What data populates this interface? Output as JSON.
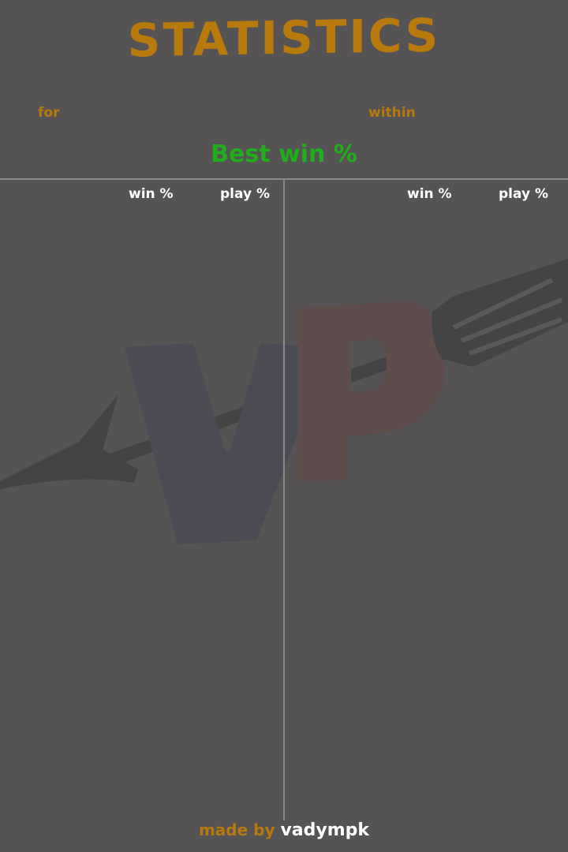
{
  "title": "STATISTICS",
  "filters": {
    "for_label": "for",
    "within_label": "within"
  },
  "sort_mode": "Best win %",
  "columns": {
    "left": {
      "win": "win %",
      "play": "play %"
    },
    "right": {
      "win": "win %",
      "play": "play %"
    }
  },
  "credits": {
    "made_by": "made by",
    "author": "vadympk"
  },
  "colors": {
    "background": "#555354",
    "accent": "#b87a0c",
    "sort_mode": "#21ad1c",
    "header_text": "#ffffff",
    "divider": "#8a8889"
  }
}
